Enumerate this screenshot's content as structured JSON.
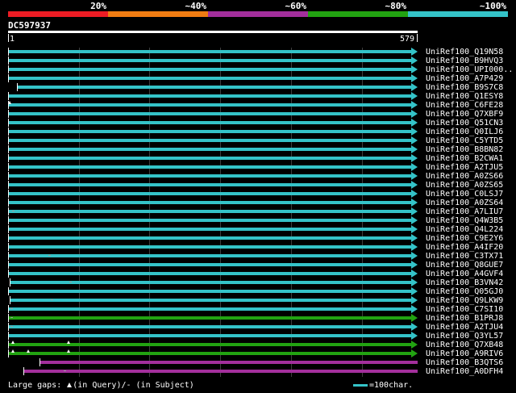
{
  "legend": {
    "items": [
      {
        "label": "20%",
        "color": "#ed1c24"
      },
      {
        "label": "~40%",
        "color": "#f07c12"
      },
      {
        "label": "~60%",
        "color": "#a32f9c"
      },
      {
        "label": "~80%",
        "color": "#22a311"
      },
      {
        "label": "~100%",
        "color": "#34c3c8"
      }
    ]
  },
  "query": {
    "id": "DC597937",
    "start": "1",
    "end": "579"
  },
  "hits": [
    {
      "id": "UniRef100_Q19N58",
      "color": "#34c3c8",
      "start": 1,
      "arrow": true,
      "gaps": []
    },
    {
      "id": "UniRef100_B9HVQ3",
      "color": "#34c3c8",
      "start": 1,
      "arrow": true,
      "gaps": []
    },
    {
      "id": "UniRef100_UPI000..",
      "color": "#34c3c8",
      "start": 1,
      "arrow": true,
      "gaps": []
    },
    {
      "id": "UniRef100_A7P429",
      "color": "#34c3c8",
      "start": 1,
      "arrow": true,
      "gaps": []
    },
    {
      "id": "UniRef100_B9S7C8",
      "color": "#34c3c8",
      "start": 14,
      "arrow": true,
      "gaps": []
    },
    {
      "id": "UniRef100_Q1ESY8",
      "color": "#34c3c8",
      "start": 1,
      "arrow": true,
      "gaps": []
    },
    {
      "id": "UniRef100_C6FE28",
      "color": "#34c3c8",
      "start": 1,
      "arrow": true,
      "gaps": [
        {
          "type": "query",
          "pos": 3
        }
      ]
    },
    {
      "id": "UniRef100_Q7XBF9",
      "color": "#34c3c8",
      "start": 1,
      "arrow": true,
      "gaps": []
    },
    {
      "id": "UniRef100_Q51CN3",
      "color": "#34c3c8",
      "start": 1,
      "arrow": true,
      "gaps": []
    },
    {
      "id": "UniRef100_Q0ILJ6",
      "color": "#34c3c8",
      "start": 1,
      "arrow": true,
      "gaps": []
    },
    {
      "id": "UniRef100_C5YTD5",
      "color": "#34c3c8",
      "start": 1,
      "arrow": true,
      "gaps": []
    },
    {
      "id": "UniRef100_B8BN82",
      "color": "#34c3c8",
      "start": 1,
      "arrow": true,
      "gaps": []
    },
    {
      "id": "UniRef100_B2CWA1",
      "color": "#34c3c8",
      "start": 1,
      "arrow": true,
      "gaps": []
    },
    {
      "id": "UniRef100_A2TJU5",
      "color": "#34c3c8",
      "start": 1,
      "arrow": true,
      "gaps": []
    },
    {
      "id": "UniRef100_A0ZS66",
      "color": "#34c3c8",
      "start": 1,
      "arrow": true,
      "gaps": []
    },
    {
      "id": "UniRef100_A0ZS65",
      "color": "#34c3c8",
      "start": 1,
      "arrow": true,
      "gaps": []
    },
    {
      "id": "UniRef100_C0LSJ7",
      "color": "#34c3c8",
      "start": 1,
      "arrow": true,
      "gaps": []
    },
    {
      "id": "UniRef100_A0ZS64",
      "color": "#34c3c8",
      "start": 1,
      "arrow": true,
      "gaps": []
    },
    {
      "id": "UniRef100_A7LIU7",
      "color": "#34c3c8",
      "start": 1,
      "arrow": true,
      "gaps": [
        {
          "type": "subject",
          "pos": 8
        }
      ]
    },
    {
      "id": "UniRef100_Q4W3B5",
      "color": "#34c3c8",
      "start": 1,
      "arrow": true,
      "gaps": []
    },
    {
      "id": "UniRef100_Q4L224",
      "color": "#34c3c8",
      "start": 1,
      "arrow": true,
      "gaps": []
    },
    {
      "id": "UniRef100_C9E2Y6",
      "color": "#34c3c8",
      "start": 1,
      "arrow": true,
      "gaps": []
    },
    {
      "id": "UniRef100_A4IF20",
      "color": "#34c3c8",
      "start": 1,
      "arrow": true,
      "gaps": []
    },
    {
      "id": "UniRef100_C3TX71",
      "color": "#34c3c8",
      "start": 1,
      "arrow": true,
      "gaps": [
        {
          "type": "subject",
          "pos": 59
        }
      ]
    },
    {
      "id": "UniRef100_Q8GUE7",
      "color": "#34c3c8",
      "start": 1,
      "arrow": true,
      "gaps": []
    },
    {
      "id": "UniRef100_A4GVF4",
      "color": "#34c3c8",
      "start": 1,
      "arrow": true,
      "gaps": []
    },
    {
      "id": "UniRef100_B3VN42",
      "color": "#34c3c8",
      "start": 3,
      "arrow": true,
      "gaps": [
        {
          "type": "subject",
          "pos": 89
        }
      ]
    },
    {
      "id": "UniRef100_Q05GJ0",
      "color": "#34c3c8",
      "start": 1,
      "arrow": true,
      "gaps": []
    },
    {
      "id": "UniRef100_Q9LKW9",
      "color": "#34c3c8",
      "start": 3,
      "arrow": true,
      "gaps": [
        {
          "type": "subject",
          "pos": 63
        }
      ]
    },
    {
      "id": "UniRef100_C7SI10",
      "color": "#34c3c8",
      "start": 1,
      "arrow": true,
      "gaps": [
        {
          "type": "subject",
          "pos": 6
        }
      ]
    },
    {
      "id": "UniRef100_B1PRJ8",
      "color": "#22a311",
      "start": 1,
      "arrow": true,
      "gaps": [
        {
          "type": "subject",
          "pos": 6
        }
      ]
    },
    {
      "id": "UniRef100_A2TJU4",
      "color": "#34c3c8",
      "start": 1,
      "arrow": true,
      "gaps": [
        {
          "type": "subject",
          "pos": 6
        }
      ]
    },
    {
      "id": "UniRef100_Q3YL57",
      "color": "#34c3c8",
      "start": 1,
      "arrow": true,
      "gaps": []
    },
    {
      "id": "UniRef100_Q7XB48",
      "color": "#22a311",
      "start": 1,
      "arrow": true,
      "gaps": [
        {
          "type": "query",
          "pos": 8
        },
        {
          "type": "query",
          "pos": 87
        }
      ]
    },
    {
      "id": "UniRef100_A9RIV6",
      "color": "#22a311",
      "start": 1,
      "arrow": true,
      "gaps": [
        {
          "type": "query",
          "pos": 8
        },
        {
          "type": "query",
          "pos": 29
        },
        {
          "type": "query",
          "pos": 87
        }
      ]
    },
    {
      "id": "UniRef100_B3QTS6",
      "color": "#a32f9c",
      "start": 46,
      "arrow": false,
      "gaps": []
    },
    {
      "id": "UniRef100_A0DFH4",
      "color": "#a32f9c",
      "start": 23,
      "arrow": false,
      "gaps": [
        {
          "type": "subject",
          "pos": 81
        }
      ]
    }
  ],
  "footer": {
    "gap_prefix": "Large gaps:",
    "gap_query": "(in Query)/- (in Subject)",
    "scale": "=100char."
  }
}
